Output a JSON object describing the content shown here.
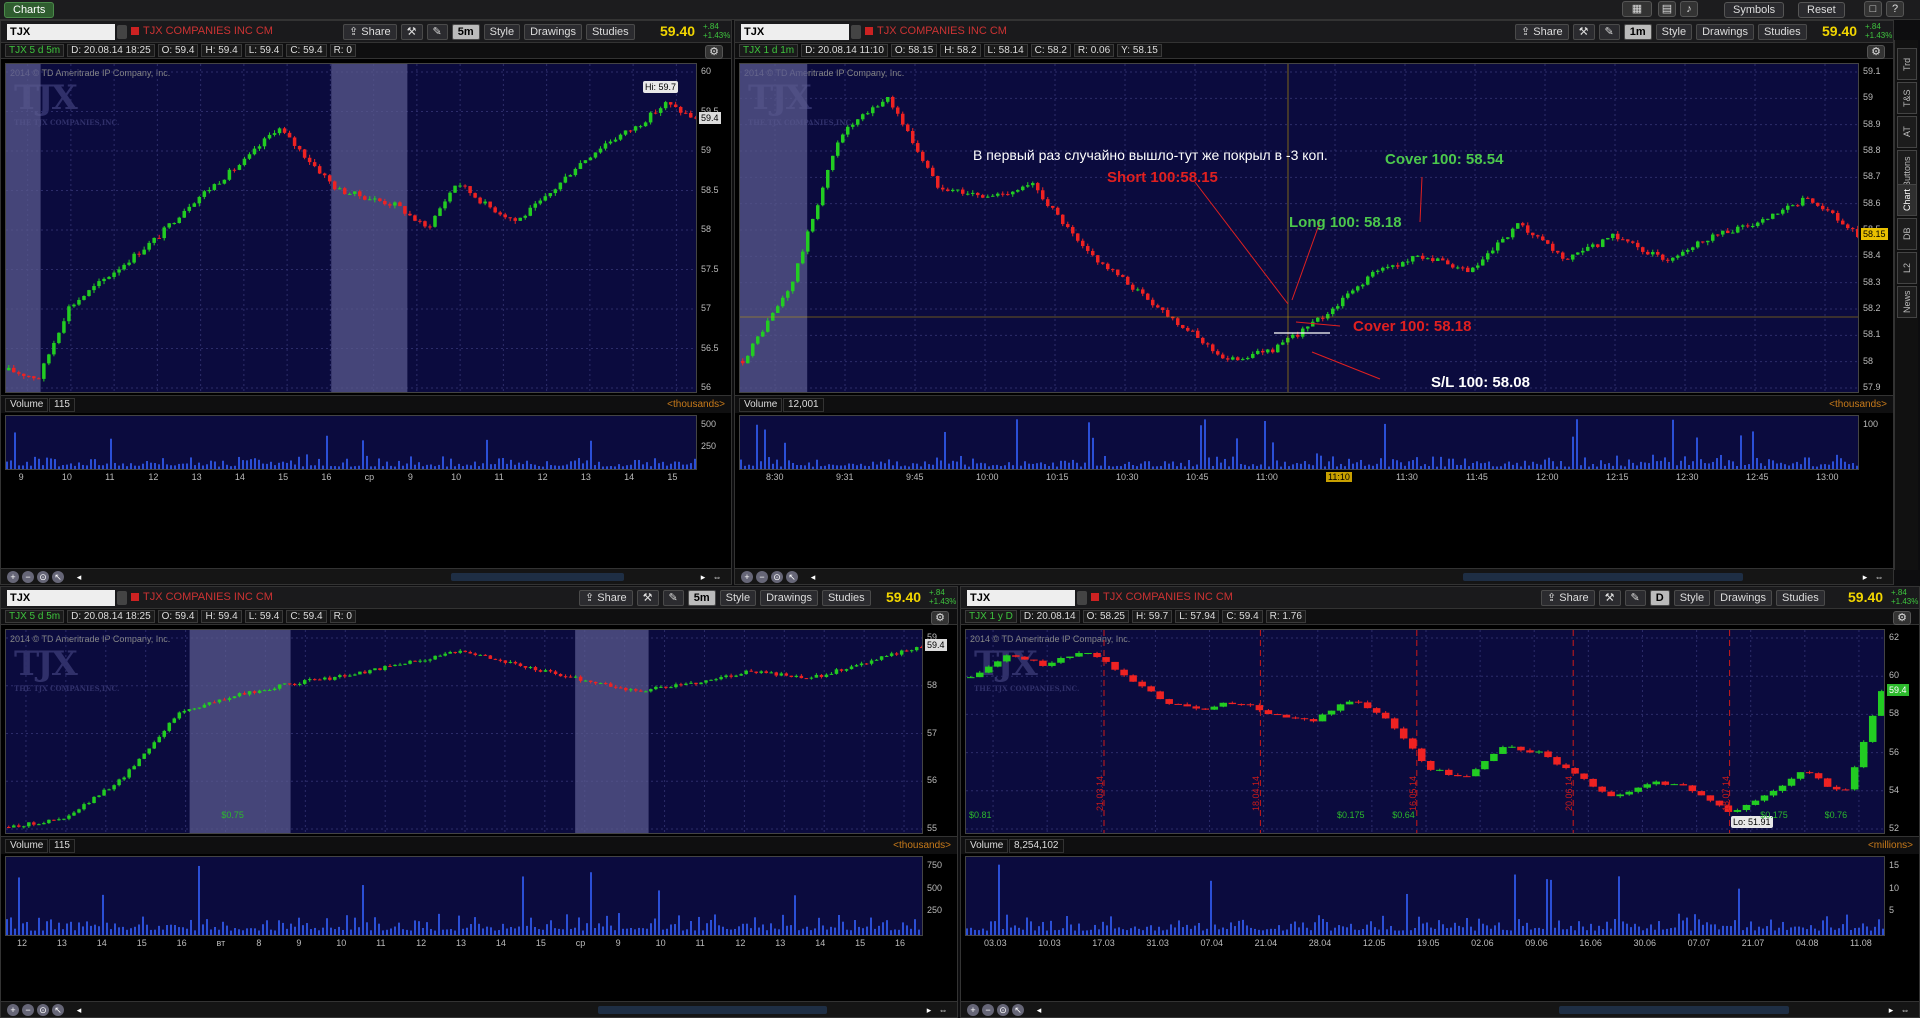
{
  "app": {
    "tab": "Charts",
    "symbols_btn": "Symbols",
    "reset_btn": "Reset"
  },
  "colors": {
    "bg": "#0b0b3e",
    "up": "#22cc22",
    "down": "#ee2222",
    "accent": "#f2d600"
  },
  "toolbar": {
    "share": "Share",
    "style": "Style",
    "drawings": "Drawings",
    "studies": "Studies"
  },
  "common": {
    "company": "TJX COMPANIES INC CM",
    "last": "59.40",
    "chg_abs": "+.84",
    "chg_pct": "+1.43%",
    "copyright": "2014 © TD Ameritrade IP Company, Inc.",
    "logo": "TJX",
    "logo_sub": "THE TJX COMPANIES,INC.",
    "volume_label": "Volume"
  },
  "panels": [
    {
      "symbol": "TJX",
      "timeframe": "5m",
      "title": "TJX 5 d 5m",
      "info": [
        "D: 20.08.14 18:25",
        "O: 59.4",
        "H: 59.4",
        "L: 59.4",
        "C: 59.4",
        "R: 0"
      ],
      "yticks": [
        "60",
        "59.5",
        "59",
        "58.5",
        "58",
        "57.5",
        "57",
        "56.5",
        "56"
      ],
      "xticks": [
        "9",
        "10",
        "11",
        "12",
        "13",
        "14",
        "15",
        "16",
        "cp",
        "9",
        "10",
        "11",
        "12",
        "13",
        "14",
        "15"
      ],
      "price_tag": "59.4",
      "hi_label": "Hi: 59.7",
      "volume_value": "115",
      "volume_unit": "<thousands>",
      "vol_ticks": [
        "500",
        "250"
      ]
    },
    {
      "symbol": "TJX",
      "timeframe": "1m",
      "title": "TJX 1 d 1m",
      "info": [
        "D: 20.08.14 11:10",
        "O: 58.15",
        "H: 58.2",
        "L: 58.14",
        "C: 58.2",
        "R: 0.06",
        "Y: 58.15"
      ],
      "yticks": [
        "59.1",
        "59",
        "58.9",
        "58.8",
        "58.7",
        "58.6",
        "58.5",
        "58.4",
        "58.3",
        "58.2",
        "58.1",
        "58",
        "57.9"
      ],
      "xticks": [
        "8:30",
        "9:31",
        "9:45",
        "10:00",
        "10:15",
        "10:30",
        "10:45",
        "11:00",
        "11:10",
        "11:30",
        "11:45",
        "12:00",
        "12:15",
        "12:30",
        "12:45",
        "13:00"
      ],
      "price_tag": "58.15",
      "volume_value": "12,001",
      "volume_unit": "<thousands>",
      "vol_ticks": [
        "100"
      ],
      "annotations": {
        "note": "В первый раз случайно вышло-тут же покрыл в -3 коп.",
        "short": "Short 100:58.15",
        "long": "Long 100: 58.18",
        "cover1": "Cover 100: 58.54",
        "cover2": "Cover 100: 58.18",
        "sl": "S/L 100: 58.08"
      }
    },
    {
      "symbol": "TJX",
      "timeframe": "5m",
      "title": "TJX 5 d 5m",
      "info": [
        "D: 20.08.14 18:25",
        "O: 59.4",
        "H: 59.4",
        "L: 59.4",
        "C: 59.4",
        "R: 0"
      ],
      "yticks": [
        "59",
        "58",
        "57",
        "56",
        "55"
      ],
      "xticks": [
        "12",
        "13",
        "14",
        "15",
        "16",
        "вт",
        "8",
        "9",
        "10",
        "11",
        "12",
        "13",
        "14",
        "15",
        "cp",
        "9",
        "10",
        "11",
        "12",
        "13",
        "14",
        "15",
        "16"
      ],
      "price_tag": "59.4",
      "div_label": "$0.75",
      "volume_value": "115",
      "volume_unit": "<thousands>",
      "vol_ticks": [
        "750",
        "500",
        "250"
      ]
    },
    {
      "symbol": "TJX",
      "timeframe": "D",
      "title": "TJX 1 y D",
      "info": [
        "D: 20.08.14",
        "O: 58.25",
        "H: 59.7",
        "L: 57.94",
        "C: 59.4",
        "R: 1.76"
      ],
      "yticks": [
        "62",
        "60",
        "58",
        "56",
        "54",
        "52"
      ],
      "xticks": [
        "03.03",
        "10.03",
        "17.03",
        "31.03",
        "07.04",
        "21.04",
        "28.04",
        "12.05",
        "19.05",
        "02.06",
        "09.06",
        "16.06",
        "30.06",
        "07.07",
        "21.07",
        "04.08",
        "11.08"
      ],
      "price_tag": "59.4",
      "lo_label": "Lo: 51.91",
      "date_marks": [
        "21.03.14",
        "18.04.14",
        "16.05.14",
        "20.06.14",
        "18.07.14"
      ],
      "div_labels": [
        "$0.81",
        "$0.175",
        "$0.64",
        "$0.175",
        "$0.76"
      ],
      "volume_value": "8,254,102",
      "volume_unit": "<millions>",
      "vol_ticks": [
        "15",
        "10",
        "5"
      ]
    }
  ],
  "side_tabs": [
    "Trd",
    "T&S",
    "AT",
    "Buttons",
    "Chart",
    "DB",
    "L2",
    "News"
  ],
  "chart_data": [
    {
      "type": "candlestick",
      "title": "TJX 5 d 5m",
      "ylim": [
        56,
        60
      ],
      "series": [
        {
          "name": "TJX",
          "values": [
            56.2,
            56.1,
            57.0,
            57.3,
            57.6,
            57.9,
            58.3,
            58.6,
            58.9,
            59.3,
            58.9,
            58.5,
            58.4,
            58.3,
            58.0,
            58.6,
            58.3,
            58.1,
            58.4,
            58.8,
            59.1,
            59.3,
            59.6,
            59.4
          ]
        }
      ]
    },
    {
      "type": "candlestick",
      "title": "TJX 1 d 1m",
      "ylim": [
        57.9,
        59.15
      ],
      "series": [
        {
          "name": "TJX",
          "values": [
            58.0,
            58.3,
            58.9,
            59.05,
            58.7,
            58.65,
            58.7,
            58.45,
            58.3,
            58.15,
            58.0,
            58.05,
            58.18,
            58.35,
            58.42,
            58.35,
            58.54,
            58.4,
            58.5,
            58.4,
            58.5,
            58.55,
            58.65,
            58.5
          ]
        }
      ]
    },
    {
      "type": "candlestick",
      "title": "TJX 5 d 5m",
      "ylim": [
        55,
        59.6
      ],
      "series": [
        {
          "name": "TJX",
          "values": [
            55.0,
            55.2,
            56.2,
            57.8,
            58.2,
            58.5,
            58.7,
            59.0,
            59.3,
            58.9,
            58.6,
            58.3,
            58.5,
            58.8,
            58.6,
            59.0,
            59.4
          ]
        }
      ]
    },
    {
      "type": "candlestick",
      "title": "TJX 1 y D",
      "ylim": [
        51.5,
        62.5
      ],
      "series": [
        {
          "name": "TJX",
          "values": [
            60.2,
            61.5,
            60.9,
            61.8,
            60.5,
            58.9,
            58.3,
            58.8,
            58.0,
            57.6,
            58.9,
            57.8,
            55.0,
            54.3,
            56.2,
            55.8,
            54.4,
            53.2,
            54.2,
            53.7,
            52.3,
            53.4,
            54.8,
            53.3,
            59.4
          ]
        }
      ]
    }
  ]
}
